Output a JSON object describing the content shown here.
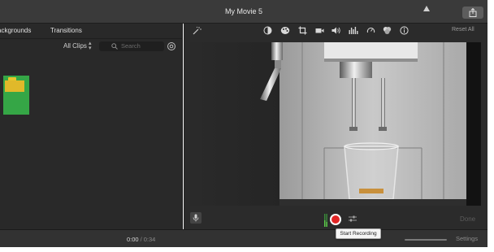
{
  "window": {
    "title": "My Movie 5"
  },
  "browser": {
    "tabs": [
      "ackgrounds",
      "Transitions"
    ],
    "filter_label": "All Clips",
    "search_placeholder": "Search"
  },
  "viewer": {
    "reset_label": "Reset All",
    "done_label": "Done",
    "tools": [
      "color-balance-icon",
      "color-correction-icon",
      "crop-icon",
      "stabilization-icon",
      "volume-icon",
      "noise-reduction-icon",
      "speed-icon",
      "clip-filter-icon",
      "info-icon"
    ]
  },
  "tooltip": {
    "text": "Start Recording"
  },
  "timeline": {
    "current_time": "0:00",
    "separator": "/",
    "total_time": "0:34",
    "settings_label": "Settings"
  },
  "colors": {
    "record": "#e22626",
    "background_thumb": "#35a646",
    "panel": "#2b2b2b"
  }
}
